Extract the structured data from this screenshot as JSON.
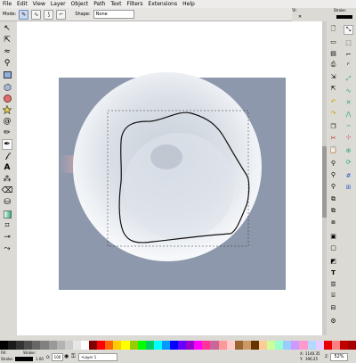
{
  "menubar": {
    "items": [
      "File",
      "Edit",
      "View",
      "Layer",
      "Object",
      "Path",
      "Text",
      "Filters",
      "Extensions",
      "Help"
    ]
  },
  "tool_controls": {
    "mode_label": "Mode:",
    "shape_label": "Shape:",
    "shape_value": "None"
  },
  "fill_stroke": {
    "fill_label": "Fill:",
    "stroke_label": "Stroke:"
  },
  "toolbox": {
    "icons": [
      "selector-icon",
      "node-editor-icon",
      "tweak-icon",
      "zoom-icon",
      "rectangle-icon",
      "3d-box-icon",
      "ellipse-icon",
      "star-icon",
      "spiral-icon",
      "pencil-icon",
      "pen-icon",
      "calligraphy-icon",
      "text-icon",
      "spray-icon",
      "eraser-icon",
      "paint-bucket-icon",
      "gradient-icon",
      "mesh-icon",
      "dropper-icon",
      "connector-icon"
    ],
    "active": "pen-icon"
  },
  "commands": {
    "icons": [
      "new-document-icon",
      "open-icon",
      "save-icon",
      "print-icon",
      "import-icon",
      "export-icon",
      "undo-icon",
      "redo-icon",
      "copy-icon",
      "cut-icon",
      "paste-icon",
      "zoom-selection-icon",
      "zoom-drawing-icon",
      "zoom-page-icon",
      "duplicate-icon",
      "clone-icon",
      "unlink-clone-icon",
      "group-icon",
      "ungroup-icon",
      "fill-stroke-icon",
      "text-font-icon",
      "layers-icon",
      "xml-editor-icon",
      "align-icon",
      "preferences-icon"
    ]
  },
  "snap": {
    "icons": [
      "snap-toggle-icon",
      "snap-bbox-icon",
      "snap-bbox-edge-icon",
      "snap-bbox-corner-icon",
      "snap-nodes-icon",
      "snap-path-icon",
      "snap-intersection-icon",
      "snap-cusp-icon",
      "snap-smooth-icon",
      "snap-midpoint-icon",
      "snap-center-icon",
      "snap-rotation-center-icon",
      "snap-grid-icon",
      "snap-guide-icon"
    ]
  },
  "palette": {
    "colors": [
      "#000000",
      "#1a1a1a",
      "#333333",
      "#4d4d4d",
      "#666666",
      "#808080",
      "#999999",
      "#b3b3b3",
      "#cccccc",
      "#e6e6e6",
      "#ffffff",
      "#800000",
      "#ff0000",
      "#ff6600",
      "#ffcc00",
      "#ffff00",
      "#99cc00",
      "#00ff00",
      "#00cc66",
      "#00ffff",
      "#0099ff",
      "#0000ff",
      "#6600ff",
      "#9900cc",
      "#ff00ff",
      "#ff3399",
      "#cc6699",
      "#ff9999",
      "#ffcccc",
      "#996633",
      "#cc9966",
      "#663300",
      "#ffcc99",
      "#ccff99",
      "#99ffcc",
      "#99ccff",
      "#cc99ff",
      "#ff99cc",
      "#b3d9ff",
      "#e6ccff",
      "#e60000",
      "#ff8080",
      "#c00000",
      "#a40000"
    ]
  },
  "statusbar": {
    "fill_label": "Fill:",
    "stroke_label": "Stroke:",
    "stroke_width": "1.00",
    "opacity_label": "O:",
    "opacity_value": "100",
    "layer_value": "•Layer 1",
    "x_label": "X:",
    "x_value": "1140.35",
    "y_label": "Y:",
    "y_value": "396.25",
    "zoom_label": "Z:",
    "zoom_value": "52%"
  }
}
